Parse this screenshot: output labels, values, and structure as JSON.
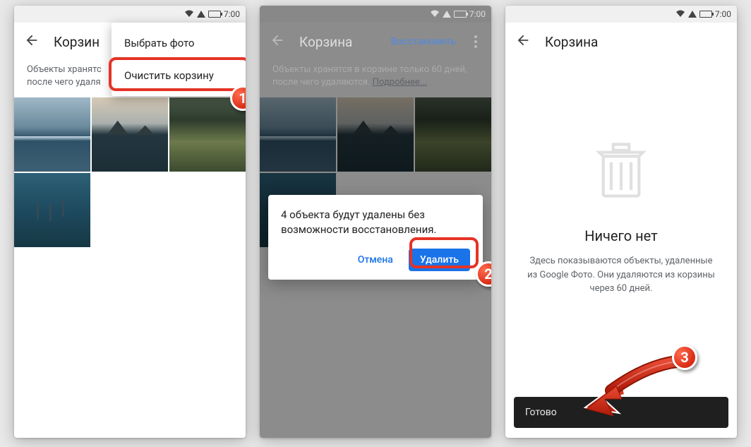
{
  "status_bar": {
    "time": "7:00"
  },
  "screen1": {
    "title": "Корзин",
    "info_line1": "Объекты хранятс",
    "info_line2": "после чего удаля",
    "menu": {
      "select_photo": "Выбрать фото",
      "clear_trash": "Очистить корзину"
    },
    "badge": "1"
  },
  "screen2": {
    "title": "Корзина",
    "restore": "Восстановить",
    "info": "Объекты хранятся в корзине только 60 дней, после чего удаляются. ",
    "info_link": "Подробнее...",
    "dialog": {
      "message": "4 объекта будут удалены без возможности восстановления.",
      "cancel": "Отмена",
      "delete": "Удалить"
    },
    "badge": "2"
  },
  "screen3": {
    "title": "Корзина",
    "empty_title": "Ничего нет",
    "empty_desc": "Здесь показываются объекты, удаленные из Google Фото. Они удаляются из корзины через 60 дней.",
    "toast": "Готово",
    "badge": "3"
  }
}
